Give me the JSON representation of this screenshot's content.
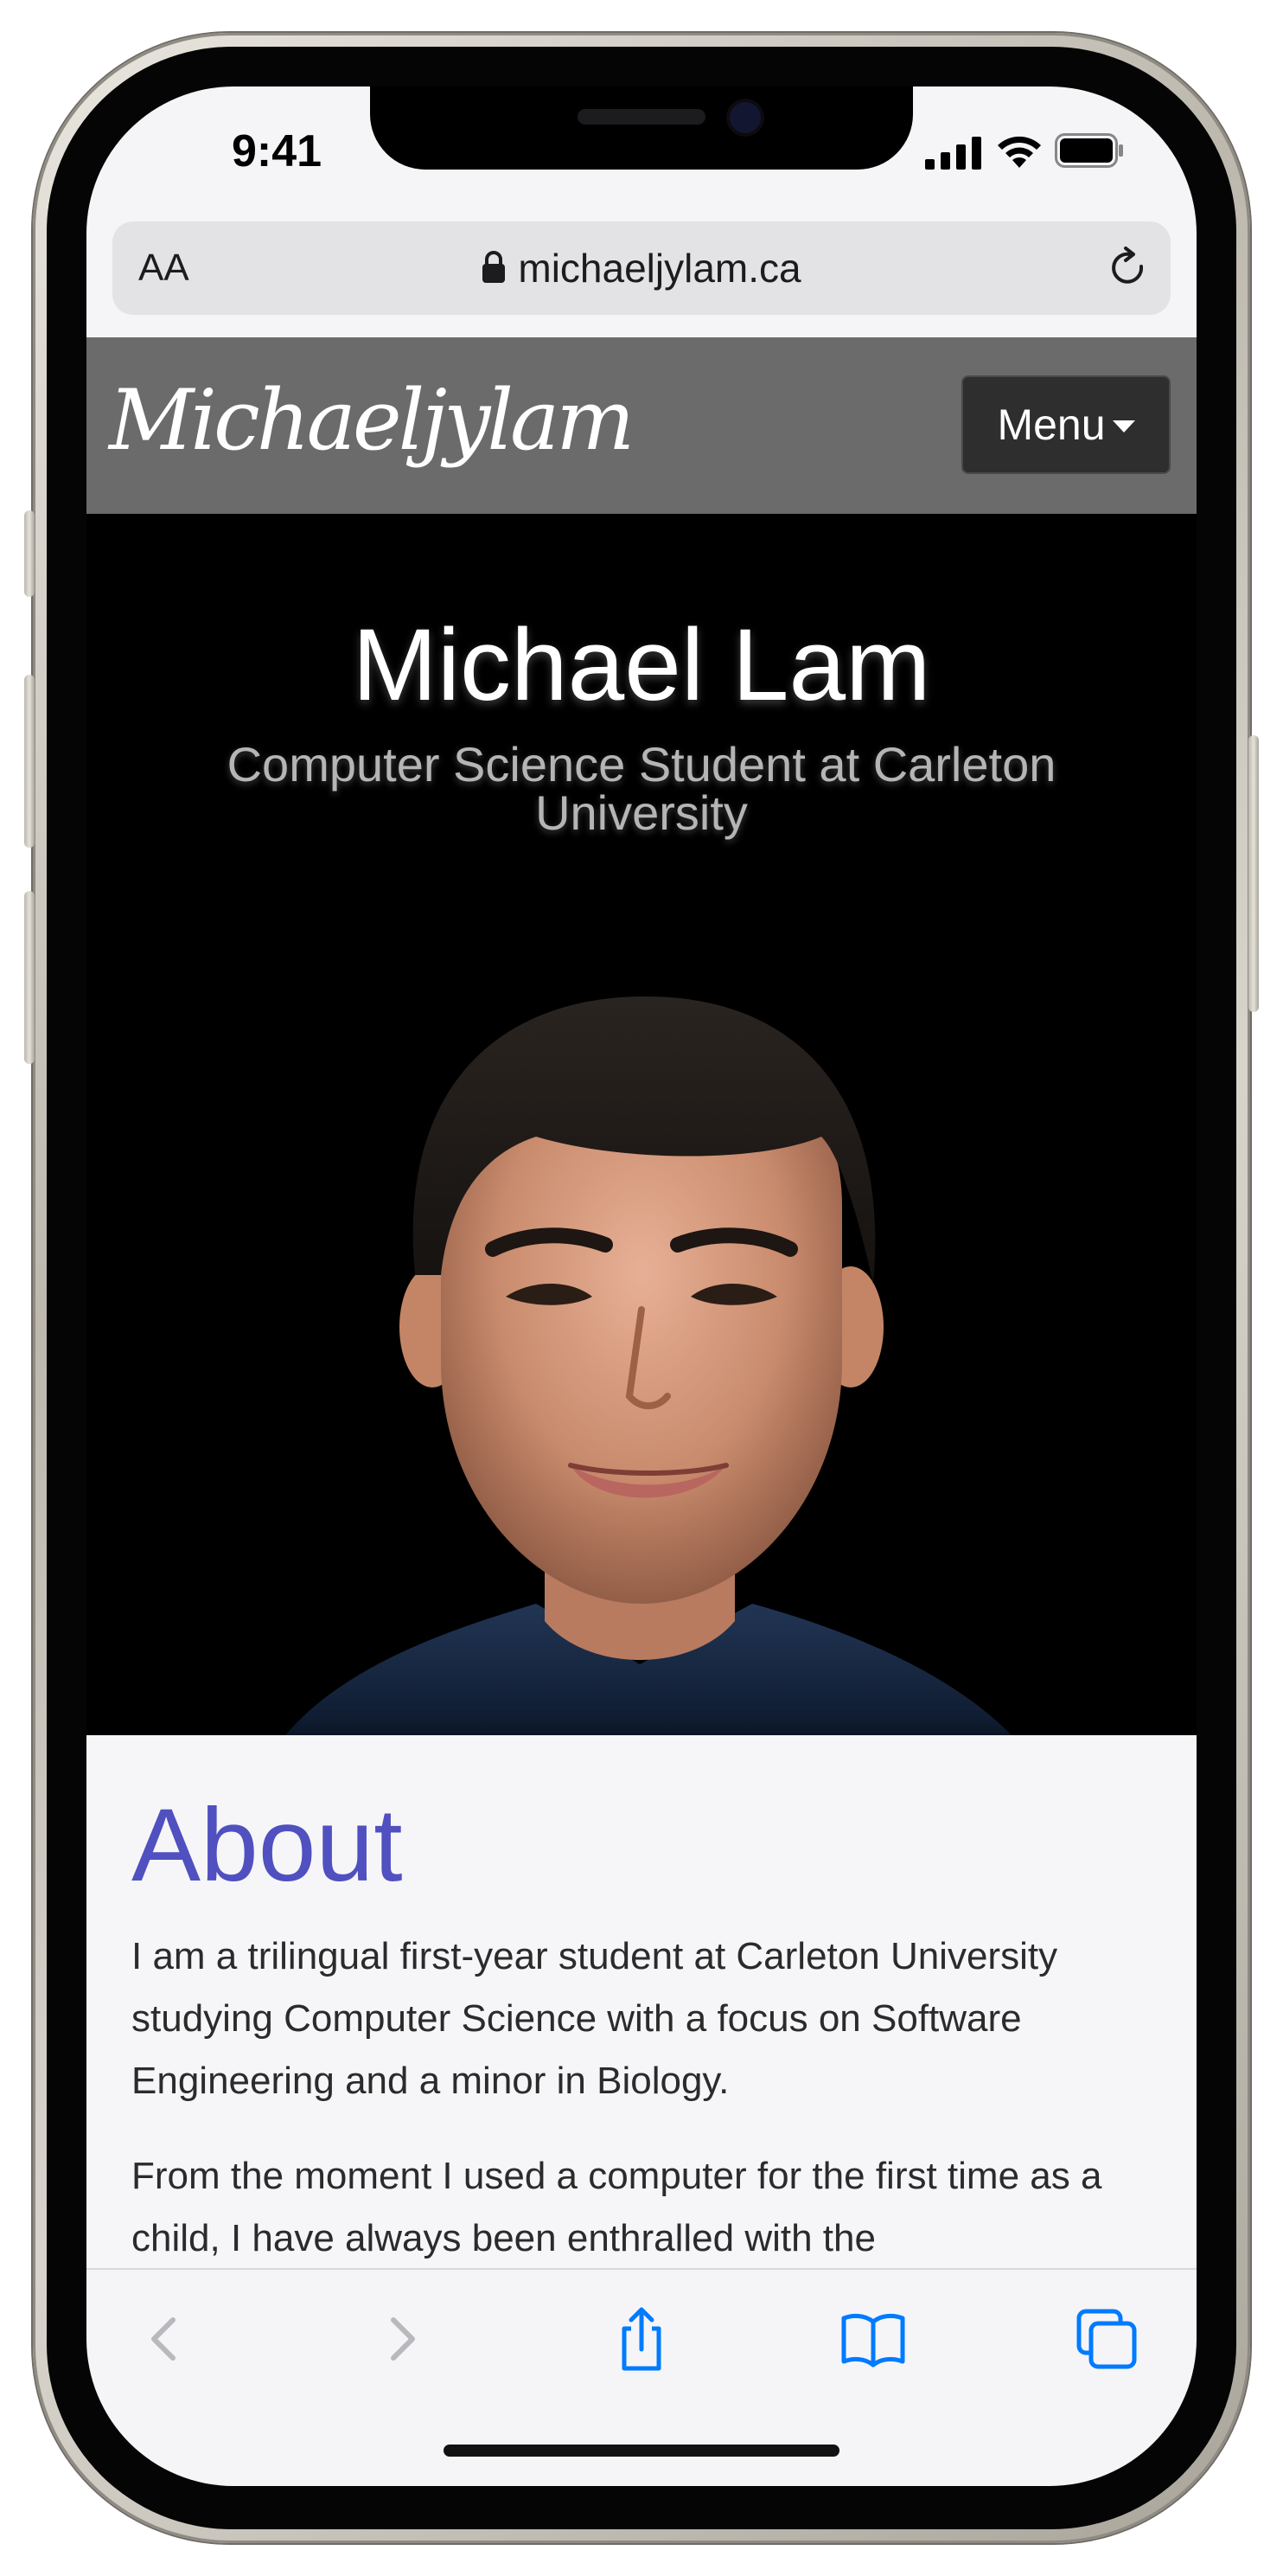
{
  "status_bar": {
    "time": "9:41"
  },
  "browser": {
    "text_size_label": "AA",
    "url": "michaeljylam.ca"
  },
  "site_nav": {
    "logo_text": "Michaeljylam",
    "menu_label": "Menu"
  },
  "hero": {
    "name": "Michael Lam",
    "subtitle": "Computer Science Student at Carleton University"
  },
  "about": {
    "heading": "About",
    "paragraph_1": "I am a trilingual first-year student at Carleton University studying Computer Science with a focus on Software Engineering and a minor in Biology.",
    "paragraph_2": "From the moment I used a computer for the first time as a child, I have always been enthralled with the"
  },
  "toolbar": {
    "items": [
      "back-icon",
      "forward-icon",
      "share-icon",
      "bookmarks-icon",
      "tabs-icon"
    ]
  },
  "colors": {
    "accent": "#007aff",
    "about_heading": "#5050c0",
    "nav_bar": "#6b6b6b"
  }
}
